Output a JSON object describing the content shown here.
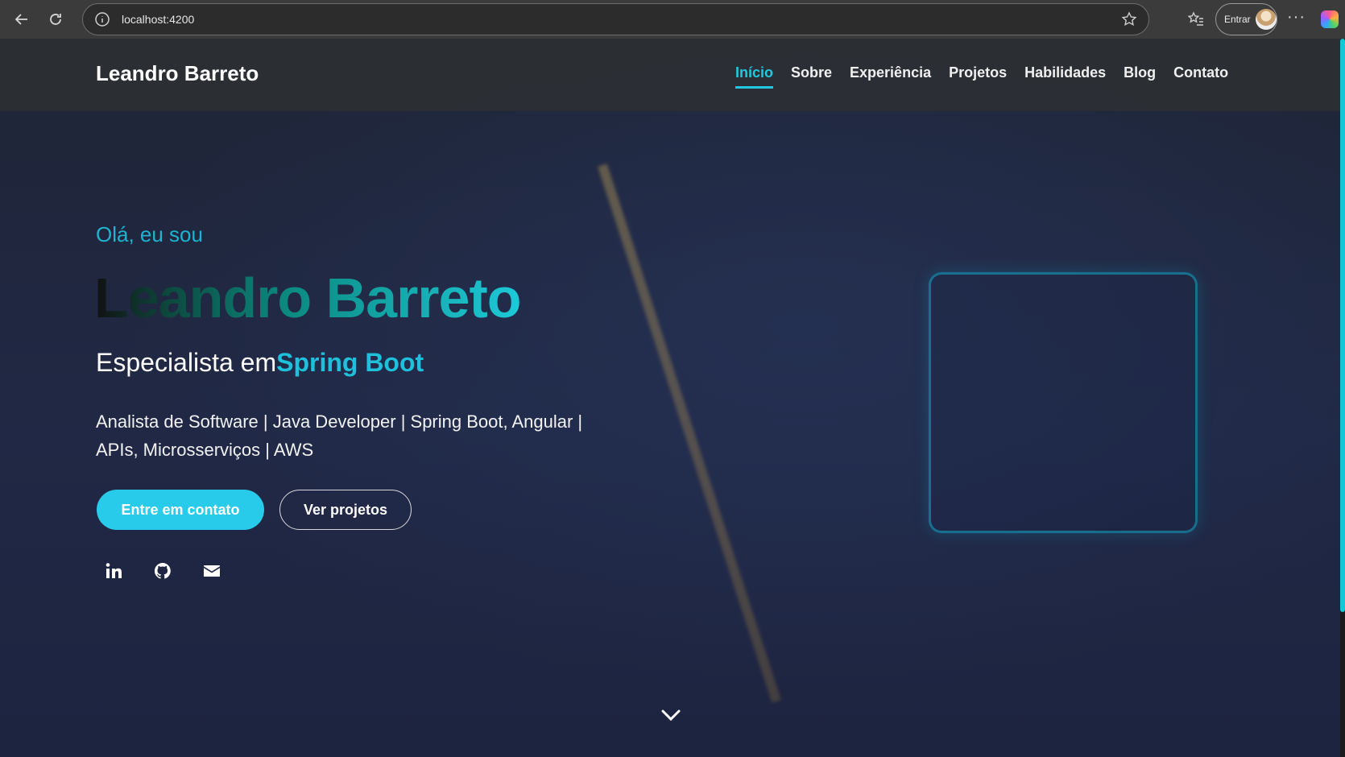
{
  "browser": {
    "url": "localhost:4200",
    "profile_label": "Entrar",
    "more_label": "···"
  },
  "header": {
    "brand": "Leandro Barreto",
    "nav": [
      {
        "label": "Início",
        "active": true
      },
      {
        "label": "Sobre"
      },
      {
        "label": "Experiência"
      },
      {
        "label": "Projetos"
      },
      {
        "label": "Habilidades"
      },
      {
        "label": "Blog"
      },
      {
        "label": "Contato"
      }
    ]
  },
  "hero": {
    "greeting": "Olá, eu sou",
    "name": "Leandro Barreto",
    "headline_prefix": "Especialista em",
    "headline_accent": "Spring Boot",
    "summary": "Analista de Software | Java Developer | Spring Boot, Angular | APIs, Microsserviços | AWS",
    "primary_button": "Entre em contato",
    "secondary_button": "Ver projetos"
  },
  "socials": [
    {
      "icon": "linkedin-icon"
    },
    {
      "icon": "github-icon"
    },
    {
      "icon": "email-icon"
    }
  ],
  "colors": {
    "accent": "#21c8e0",
    "primary_button": "#29cbea",
    "header_bg": "#2d3034"
  }
}
